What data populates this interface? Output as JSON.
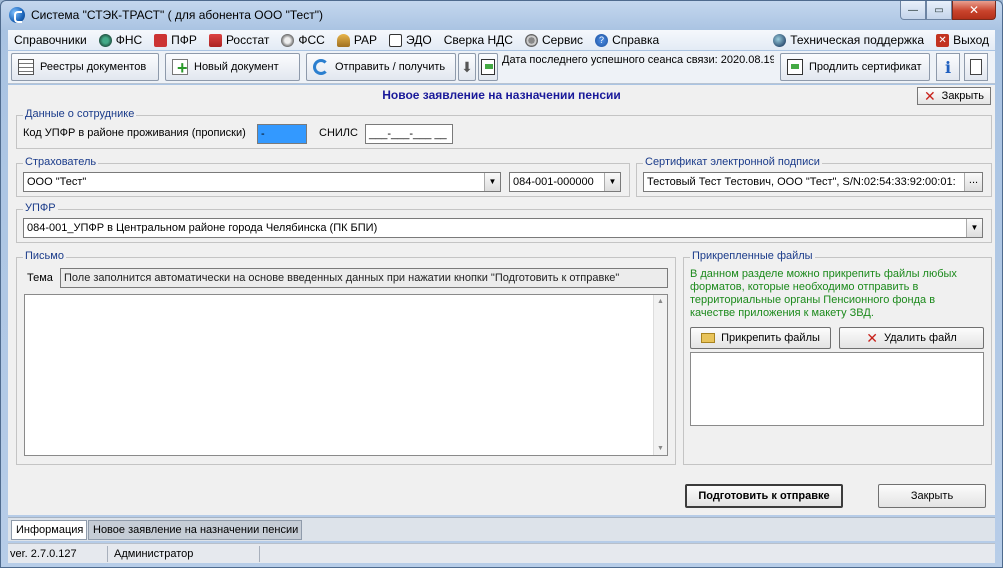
{
  "window": {
    "title": "Система \"СТЭК-ТРАСТ\" ( для абонента ООО \"Тест\")",
    "minimize": "—",
    "maximize": "▭",
    "close": "✕"
  },
  "menu": {
    "items": [
      "Справочники",
      "ФНС",
      "ПФР",
      "Росстат",
      "ФСС",
      "РАР",
      "ЭДО",
      "Сверка НДС",
      "Сервис",
      "Справка"
    ],
    "support": "Техническая поддержка",
    "exit": "Выход",
    "help_glyph": "?",
    "exit_glyph": "✕"
  },
  "toolbar": {
    "registry": "Реестры документов",
    "new_doc": "Новый документ",
    "send_receive": "Отправить / получить",
    "down_arrow": "⬇",
    "last_session": "Дата последнего успешного сеанса связи: 2020.08.19",
    "extend_cert": "Продлить сертификат",
    "info": "i"
  },
  "form": {
    "title": "Новое заявление на назначении пенсии",
    "close_top": "Закрыть",
    "employee": {
      "legend": "Данные о сотруднике",
      "upfr_code_label": "Код УПФР в районе проживания (прописки)",
      "upfr_code_value": "   -",
      "snils_label": "СНИЛС",
      "snils_value": "___-___-___ __"
    },
    "insurer": {
      "legend": "Страхователь",
      "name": "ООО \"Тест\"",
      "code": "084-001-000000"
    },
    "certificate": {
      "legend": "Сертификат электронной подписи",
      "value": "Тестовый Тест Тестович, ООО \"Тест\", S/N:02:54:33:92:00:01:",
      "ellipsis": "..."
    },
    "upfr": {
      "legend": "УПФР",
      "value": "084-001_УПФР в Центральном районе города Челябинска (ПК БПИ)"
    },
    "letter": {
      "legend": "Письмо",
      "subject_label": "Тема",
      "subject_value": "Поле заполнится автоматически на основе введенных данных при нажатии кнопки \"Подготовить к отправке\""
    },
    "attachments": {
      "legend": "Прикрепленные файлы",
      "hint_lines": [
        "В данном разделе можно прикрепить файлы любых",
        "форматов, которые необходимо отправить в",
        "территориальные органы Пенсионного фонда в",
        "качестве приложения к макету ЗВД."
      ],
      "attach_button": "Прикрепить файлы",
      "delete_button": "Удалить файл"
    },
    "prepare_button": "Подготовить к отправке",
    "close_button": "Закрыть"
  },
  "tabs": [
    "Информация",
    "Новое заявление на назначении пенсии"
  ],
  "statusbar": {
    "version": "ver. 2.7.0.127",
    "user": "Администратор"
  },
  "colors": {
    "legend": "#1a3b8a",
    "title": "#1a1a9a",
    "hint": "#1c8a1c",
    "highlight": "#3399ff",
    "delete_x": "#c8221b"
  }
}
